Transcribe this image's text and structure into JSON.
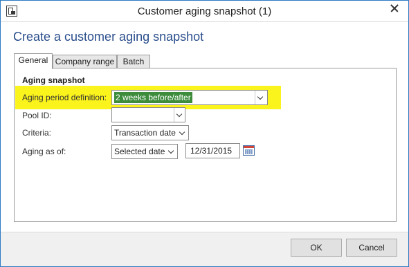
{
  "window": {
    "title": "Customer aging snapshot (1)",
    "icons": {
      "app": "app-window-icon",
      "close": "close-icon"
    }
  },
  "form": {
    "heading": "Create a customer aging snapshot"
  },
  "tabs": [
    {
      "label": "General",
      "active": true
    },
    {
      "label": "Company range",
      "active": false
    },
    {
      "label": "Batch",
      "active": false
    }
  ],
  "group": {
    "title": "Aging snapshot",
    "highlight_color": "#fbf31c"
  },
  "fields": {
    "aging_period_definition": {
      "label": "Aging period definition:",
      "value": "2 weeks before/after"
    },
    "pool_id": {
      "label": "Pool ID:",
      "value": ""
    },
    "criteria": {
      "label": "Criteria:",
      "value": "Transaction date"
    },
    "aging_as_of": {
      "label": "Aging as of:",
      "value": "Selected date",
      "date": "12/31/2015",
      "calendar_icon": "calendar-icon"
    }
  },
  "buttons": {
    "ok": "OK",
    "cancel": "Cancel"
  }
}
